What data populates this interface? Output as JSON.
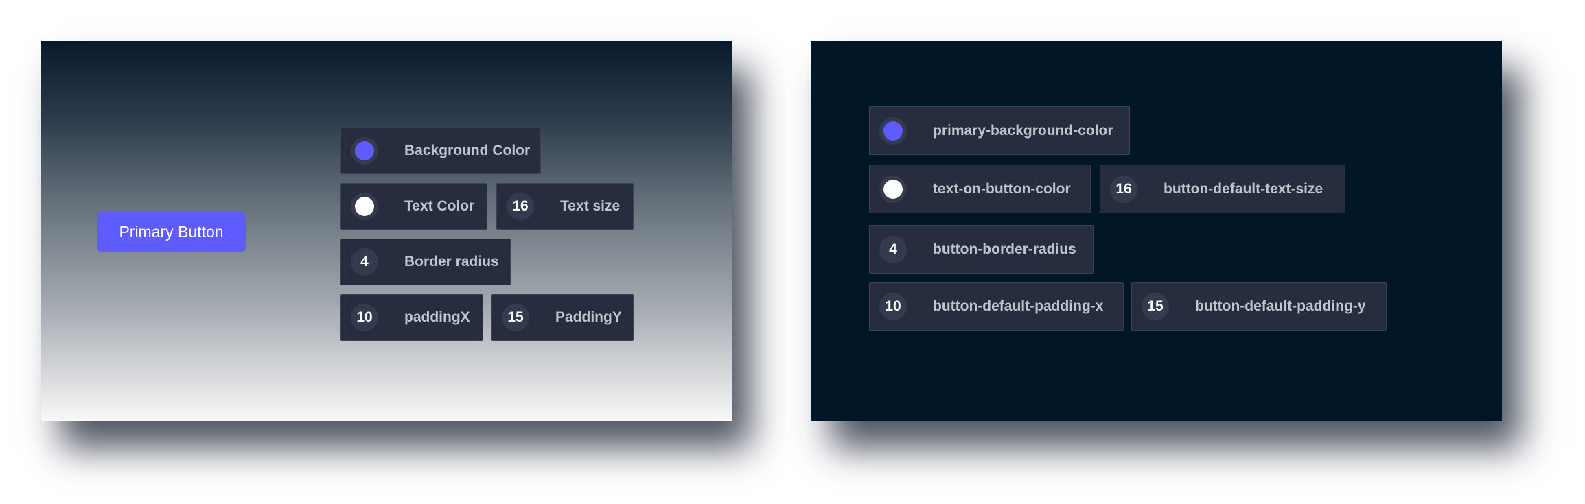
{
  "left_panel": {
    "primary_button_label": "Primary Button",
    "chips": [
      {
        "kind": "color",
        "color": "#5f5cff",
        "label": "Background Color"
      },
      {
        "kind": "color",
        "color": "#ffffff",
        "label": "Text Color"
      },
      {
        "kind": "number",
        "value": "16",
        "label": "Text size"
      },
      {
        "kind": "number",
        "value": "4",
        "label": "Border radius"
      },
      {
        "kind": "number",
        "value": "10",
        "label": "paddingX"
      },
      {
        "kind": "number",
        "value": "15",
        "label": "PaddingY"
      }
    ]
  },
  "right_panel": {
    "chips": [
      {
        "kind": "color",
        "color": "#5f5cff",
        "label": "primary-background-color"
      },
      {
        "kind": "color",
        "color": "#ffffff",
        "label": "text-on-button-color"
      },
      {
        "kind": "number",
        "value": "16",
        "label": "button-default-text-size"
      },
      {
        "kind": "number",
        "value": "4",
        "label": "button-border-radius"
      },
      {
        "kind": "number",
        "value": "10",
        "label": "button-default-padding-x"
      },
      {
        "kind": "number",
        "value": "15",
        "label": "button-default-padding-y"
      }
    ]
  },
  "colors": {
    "accent": "#5f5cff",
    "dark_bg": "#011627",
    "chip_bg": "#272c3e"
  }
}
